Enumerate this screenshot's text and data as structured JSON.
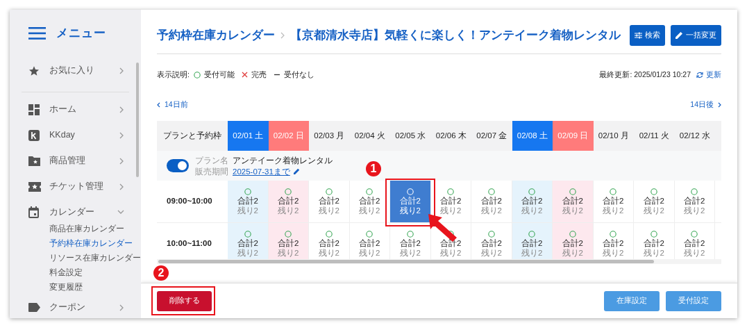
{
  "sidebar": {
    "title": "メニュー",
    "items": [
      {
        "label": "お気に入り",
        "expanded": false
      },
      {
        "label": "ホーム",
        "expanded": false
      },
      {
        "label": "KKday",
        "expanded": false
      },
      {
        "label": "商品管理",
        "expanded": false
      },
      {
        "label": "チケット管理",
        "expanded": false
      },
      {
        "label": "カレンダー",
        "expanded": true,
        "children": [
          {
            "label": "商品在庫カレンダー",
            "selected": false
          },
          {
            "label": "予約枠在庫カレンダー",
            "selected": true
          },
          {
            "label": "リソース在庫カレンダー",
            "selected": false
          },
          {
            "label": "料金設定",
            "selected": false
          },
          {
            "label": "変更履歴",
            "selected": false
          }
        ]
      },
      {
        "label": "クーポン",
        "expanded": false
      }
    ]
  },
  "breadcrumb": [
    "予約枠在庫カレンダー",
    "【京都清水寺店】気軽くに楽しく！アンテイーク着物レンタル"
  ],
  "header_buttons": [
    "検索",
    "一括変更"
  ],
  "legend": {
    "label": "表示説明:",
    "items": [
      {
        "kind": "available",
        "label": "受付可能"
      },
      {
        "kind": "sold_out",
        "label": "完売"
      },
      {
        "kind": "none",
        "label": "受付なし"
      }
    ]
  },
  "last_updated": "最終更新: 2025/01/23 10:27",
  "refresh": "更新",
  "prev": "14日前",
  "next": "14日後",
  "table": {
    "corner": "プランと予約枠",
    "dates": [
      {
        "label": "02/01 土",
        "kind": "sat"
      },
      {
        "label": "02/02 日",
        "kind": "sun"
      },
      {
        "label": "02/03 月",
        "kind": "weekday"
      },
      {
        "label": "02/04 火",
        "kind": "weekday"
      },
      {
        "label": "02/05 水",
        "kind": "weekday"
      },
      {
        "label": "02/06 木",
        "kind": "weekday"
      },
      {
        "label": "02/07 金",
        "kind": "weekday"
      },
      {
        "label": "02/08 土",
        "kind": "sat"
      },
      {
        "label": "02/09 日",
        "kind": "sun"
      },
      {
        "label": "02/10 月",
        "kind": "weekday"
      },
      {
        "label": "02/11 火",
        "kind": "weekday"
      },
      {
        "label": "02/12 水",
        "kind": "weekday"
      }
    ],
    "plan": {
      "on": true,
      "name_label": "プラン名",
      "name": "アンテイーク着物レンタル",
      "period_label": "販売期間",
      "period": "2025-07-31まで"
    },
    "rows": [
      {
        "time": "09:00~10:00",
        "cells": [
          {
            "kind": "available",
            "total": "合計2",
            "left": "残り2",
            "selected": false
          },
          {
            "kind": "available",
            "total": "合計2",
            "left": "残り2",
            "selected": false
          },
          {
            "kind": "available",
            "total": "合計2",
            "left": "残り2",
            "selected": false
          },
          {
            "kind": "available",
            "total": "合計2",
            "left": "残り2",
            "selected": false
          },
          {
            "kind": "available",
            "total": "合計2",
            "left": "残り2",
            "selected": true
          },
          {
            "kind": "available",
            "total": "合計2",
            "left": "残り2",
            "selected": false
          },
          {
            "kind": "available",
            "total": "合計2",
            "left": "残り2",
            "selected": false
          },
          {
            "kind": "available",
            "total": "合計2",
            "left": "残り2",
            "selected": false
          },
          {
            "kind": "available",
            "total": "合計2",
            "left": "残り2",
            "selected": false
          },
          {
            "kind": "available",
            "total": "合計2",
            "left": "残り2",
            "selected": false
          },
          {
            "kind": "available",
            "total": "合計2",
            "left": "残り2",
            "selected": false
          },
          {
            "kind": "available",
            "total": "合計2",
            "left": "残り2",
            "selected": false
          }
        ]
      },
      {
        "time": "10:00~11:00",
        "cells": [
          {
            "kind": "available",
            "total": "合計2",
            "left": "残り2",
            "selected": false
          },
          {
            "kind": "available",
            "total": "合計2",
            "left": "残り2",
            "selected": false
          },
          {
            "kind": "available",
            "total": "合計2",
            "left": "残り2",
            "selected": false
          },
          {
            "kind": "available",
            "total": "合計2",
            "left": "残り2",
            "selected": false
          },
          {
            "kind": "available",
            "total": "合計2",
            "left": "残り2",
            "selected": false
          },
          {
            "kind": "available",
            "total": "合計2",
            "left": "残り2",
            "selected": false
          },
          {
            "kind": "available",
            "total": "合計2",
            "left": "残り2",
            "selected": false
          },
          {
            "kind": "available",
            "total": "合計2",
            "left": "残り2",
            "selected": false
          },
          {
            "kind": "available",
            "total": "合計2",
            "left": "残り2",
            "selected": false
          },
          {
            "kind": "available",
            "total": "合計2",
            "left": "残り2",
            "selected": false
          },
          {
            "kind": "available",
            "total": "合計2",
            "left": "残り2",
            "selected": false
          },
          {
            "kind": "available",
            "total": "合計2",
            "left": "残り2",
            "selected": false
          }
        ]
      }
    ]
  },
  "footer": {
    "delete": "削除する",
    "buttons": [
      "在庫設定",
      "受付設定"
    ]
  },
  "annotations": [
    {
      "label": "1"
    },
    {
      "label": "2"
    }
  ]
}
